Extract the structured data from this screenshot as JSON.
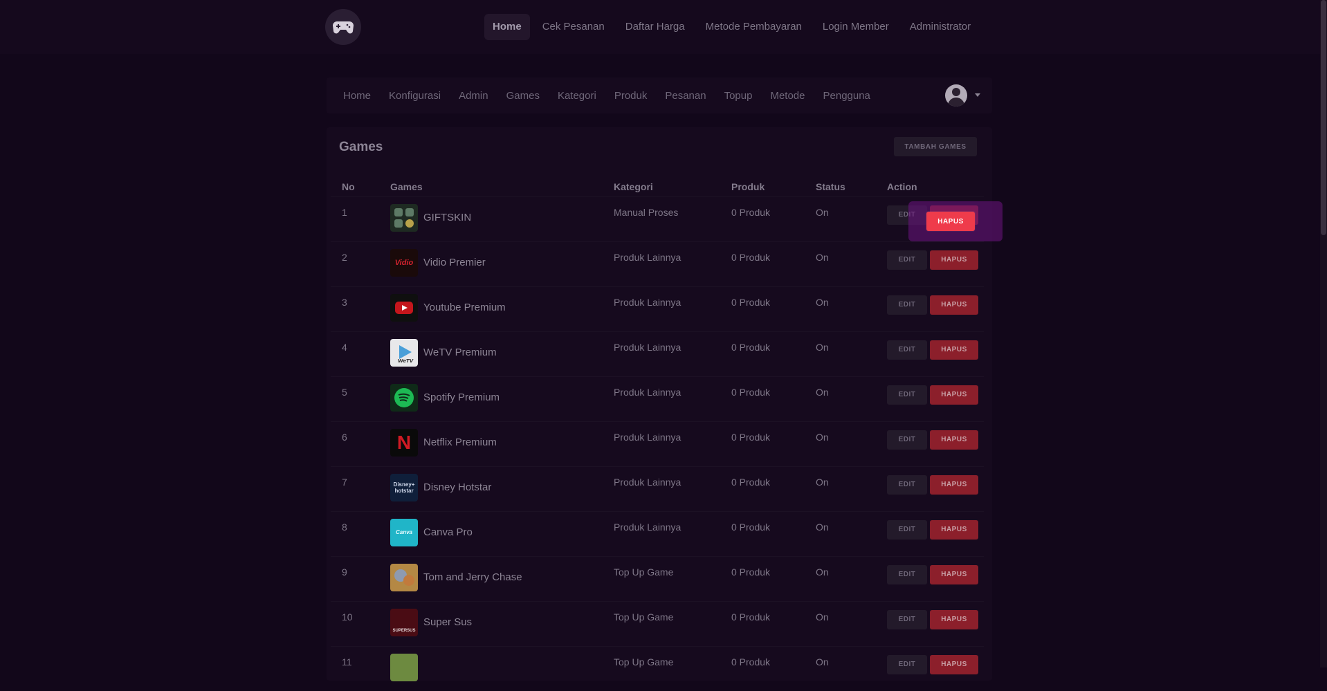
{
  "top_nav": {
    "items": [
      "Home",
      "Cek Pesanan",
      "Daftar Harga",
      "Metode Pembayaran",
      "Login Member",
      "Administrator"
    ],
    "active": "Home"
  },
  "admin_nav": {
    "items": [
      "Home",
      "Konfigurasi",
      "Admin",
      "Games",
      "Kategori",
      "Produk",
      "Pesanan",
      "Topup",
      "Metode",
      "Pengguna"
    ]
  },
  "page": {
    "title": "Games",
    "add_button": "TAMBAH GAMES"
  },
  "table": {
    "headers": [
      "No",
      "Games",
      "Kategori",
      "Produk",
      "Status",
      "Action"
    ],
    "edit_label": "EDIT",
    "delete_label": "HAPUS",
    "rows": [
      {
        "no": "1",
        "game": "GIFTSKIN",
        "kategori": "Manual Proses",
        "produk": "0 Produk",
        "status": "On",
        "icon": "giftskin-icon"
      },
      {
        "no": "2",
        "game": "Vidio Premier",
        "kategori": "Produk Lainnya",
        "produk": "0 Produk",
        "status": "On",
        "icon": "vidio-icon"
      },
      {
        "no": "3",
        "game": "Youtube Premium",
        "kategori": "Produk Lainnya",
        "produk": "0 Produk",
        "status": "On",
        "icon": "youtube-icon"
      },
      {
        "no": "4",
        "game": "WeTV Premium",
        "kategori": "Produk Lainnya",
        "produk": "0 Produk",
        "status": "On",
        "icon": "wetv-icon"
      },
      {
        "no": "5",
        "game": "Spotify Premium",
        "kategori": "Produk Lainnya",
        "produk": "0 Produk",
        "status": "On",
        "icon": "spotify-icon"
      },
      {
        "no": "6",
        "game": "Netflix Premium",
        "kategori": "Produk Lainnya",
        "produk": "0 Produk",
        "status": "On",
        "icon": "netflix-icon"
      },
      {
        "no": "7",
        "game": "Disney Hotstar",
        "kategori": "Produk Lainnya",
        "produk": "0 Produk",
        "status": "On",
        "icon": "disney-icon"
      },
      {
        "no": "8",
        "game": "Canva Pro",
        "kategori": "Produk Lainnya",
        "produk": "0 Produk",
        "status": "On",
        "icon": "canva-icon"
      },
      {
        "no": "9",
        "game": "Tom and Jerry Chase",
        "kategori": "Top Up Game",
        "produk": "0 Produk",
        "status": "On",
        "icon": "tomjerry-icon"
      },
      {
        "no": "10",
        "game": "Super Sus",
        "kategori": "Top Up Game",
        "produk": "0 Produk",
        "status": "On",
        "icon": "supersus-icon"
      },
      {
        "no": "11",
        "game": "",
        "kategori": "Top Up Game",
        "produk": "0 Produk",
        "status": "On",
        "icon": "game-icon"
      }
    ]
  },
  "colors": {
    "background": "#12071a",
    "card": "#160a1e",
    "delete": "#8c1f2b",
    "delete_active": "#ef3b4b",
    "focus": "#6e1482"
  }
}
